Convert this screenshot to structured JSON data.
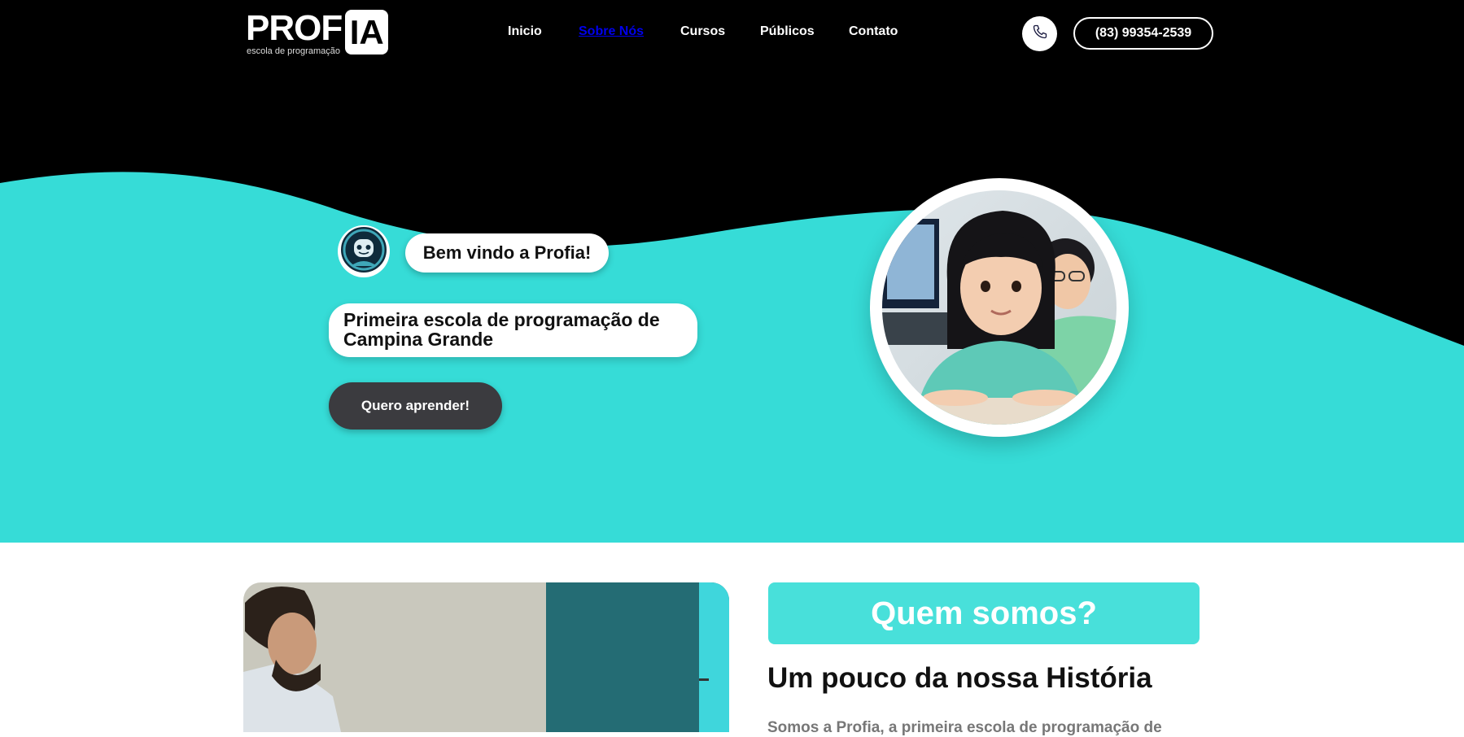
{
  "brand": {
    "logo_main": "PROF",
    "logo_box": "IA",
    "logo_sub": "escola de programação"
  },
  "nav": {
    "items": [
      {
        "label": "Inicio",
        "active": false
      },
      {
        "label": "Sobre Nós",
        "active": true
      },
      {
        "label": "Cursos",
        "active": false
      },
      {
        "label": "Públicos",
        "active": false
      },
      {
        "label": "Contato",
        "active": false
      }
    ]
  },
  "contact": {
    "phone": "(83) 99354-2539",
    "phone_icon": "phone-icon"
  },
  "hero": {
    "welcome": "Bem vindo a Profia!",
    "tagline": "Primeira escola de programação de Campina Grande",
    "cta": "Quero aprender!",
    "avatar_icon": "robot-avatar-icon"
  },
  "about": {
    "badge": "Quem somos?",
    "heading": "Um pouco da nossa História",
    "text": "Somos a Profia, a primeira escola de programação de"
  },
  "colors": {
    "header_bg": "#000000",
    "accent": "#36dcd7",
    "badge": "#48e0da",
    "cta_bg": "#3b3b3f",
    "nav_active": "#0000ee"
  }
}
